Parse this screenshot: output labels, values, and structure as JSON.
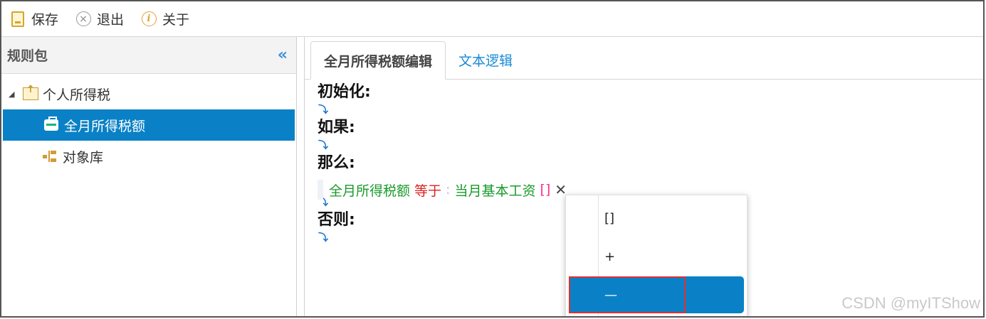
{
  "toolbar": {
    "save_label": "保存",
    "exit_label": "退出",
    "exit_icon_glyph": "×",
    "about_label": "关于",
    "about_icon_glyph": "i"
  },
  "left_panel": {
    "title": "规则包",
    "collapse_glyph": "«",
    "tree": {
      "root_label": "个人所得税",
      "children": [
        {
          "label": "全月所得税额",
          "selected": true,
          "icon": "package-icon"
        },
        {
          "label": "对象库",
          "selected": false,
          "icon": "library-tree-icon"
        }
      ]
    }
  },
  "tabs": [
    {
      "label": "全月所得税额编辑",
      "active": true
    },
    {
      "label": "文本逻辑",
      "active": false
    }
  ],
  "editor": {
    "sections": {
      "init": "初始化:",
      "if": "如果:",
      "then": "那么:",
      "else": "否则:"
    },
    "arrow_glyph": "⤵",
    "action": {
      "left_var": "全月所得税额",
      "operator": "等于",
      "colon": ":",
      "right_var": "当月基本工资",
      "bracket": "[]",
      "delete_glyph": "✕"
    }
  },
  "dropdown": {
    "items": [
      {
        "label": "[]",
        "selected": false
      },
      {
        "label": "+",
        "selected": false
      },
      {
        "label": "—",
        "selected": true
      }
    ]
  },
  "watermark": "CSDN @myITShow",
  "colors": {
    "accent": "#0a81c6",
    "green_text": "#1a9a2a",
    "red_text": "#e02020",
    "tab_link": "#1a8ad4",
    "highlight_box": "#e03030"
  }
}
